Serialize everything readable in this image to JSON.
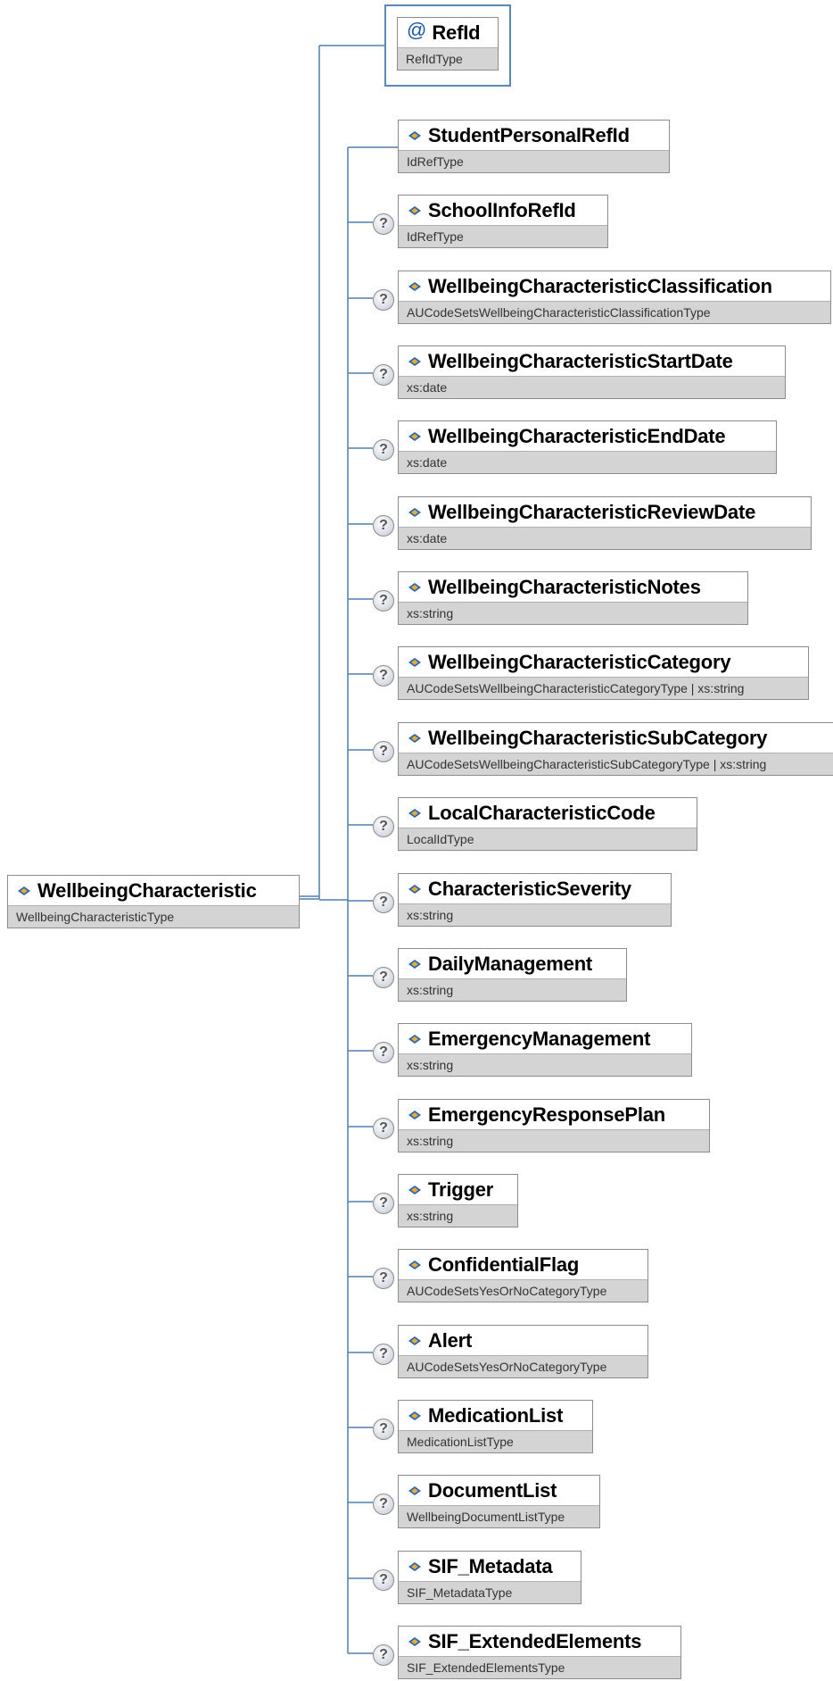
{
  "root": {
    "name": "WellbeingCharacteristic",
    "type": "WellbeingCharacteristicType"
  },
  "attribute": {
    "symbol": "@",
    "name": "RefId",
    "type": "RefIdType"
  },
  "optional_marker": "?",
  "elements": [
    {
      "name": "StudentPersonalRefId",
      "type": "IdRefType",
      "optional": false
    },
    {
      "name": "SchoolInfoRefId",
      "type": "IdRefType",
      "optional": true
    },
    {
      "name": "WellbeingCharacteristicClassification",
      "type": "AUCodeSetsWellbeingCharacteristicClassificationType",
      "optional": true
    },
    {
      "name": "WellbeingCharacteristicStartDate",
      "type": "xs:date",
      "optional": true
    },
    {
      "name": "WellbeingCharacteristicEndDate",
      "type": "xs:date",
      "optional": true
    },
    {
      "name": "WellbeingCharacteristicReviewDate",
      "type": "xs:date",
      "optional": true
    },
    {
      "name": "WellbeingCharacteristicNotes",
      "type": "xs:string",
      "optional": true
    },
    {
      "name": "WellbeingCharacteristicCategory",
      "type": "AUCodeSetsWellbeingCharacteristicCategoryType | xs:string",
      "optional": true
    },
    {
      "name": "WellbeingCharacteristicSubCategory",
      "type": "AUCodeSetsWellbeingCharacteristicSubCategoryType | xs:string",
      "optional": true
    },
    {
      "name": "LocalCharacteristicCode",
      "type": "LocalIdType",
      "optional": true
    },
    {
      "name": "CharacteristicSeverity",
      "type": "xs:string",
      "optional": true
    },
    {
      "name": "DailyManagement",
      "type": "xs:string",
      "optional": true
    },
    {
      "name": "EmergencyManagement",
      "type": "xs:string",
      "optional": true
    },
    {
      "name": "EmergencyResponsePlan",
      "type": "xs:string",
      "optional": true
    },
    {
      "name": "Trigger",
      "type": "xs:string",
      "optional": true
    },
    {
      "name": "ConfidentialFlag",
      "type": "AUCodeSetsYesOrNoCategoryType",
      "optional": true
    },
    {
      "name": "Alert",
      "type": "AUCodeSetsYesOrNoCategoryType",
      "optional": true
    },
    {
      "name": "MedicationList",
      "type": "MedicationListType",
      "optional": true
    },
    {
      "name": "DocumentList",
      "type": "WellbeingDocumentListType",
      "optional": true
    },
    {
      "name": "SIF_Metadata",
      "type": "SIF_MetadataType",
      "optional": true
    },
    {
      "name": "SIF_ExtendedElements",
      "type": "SIF_ExtendedElementsType",
      "optional": true
    }
  ],
  "colors": {
    "connector": "#4f7fb0",
    "type_band": "#d4d4d4",
    "icon_blue": "#2b63b8",
    "icon_gold": "#e4ad2a"
  }
}
